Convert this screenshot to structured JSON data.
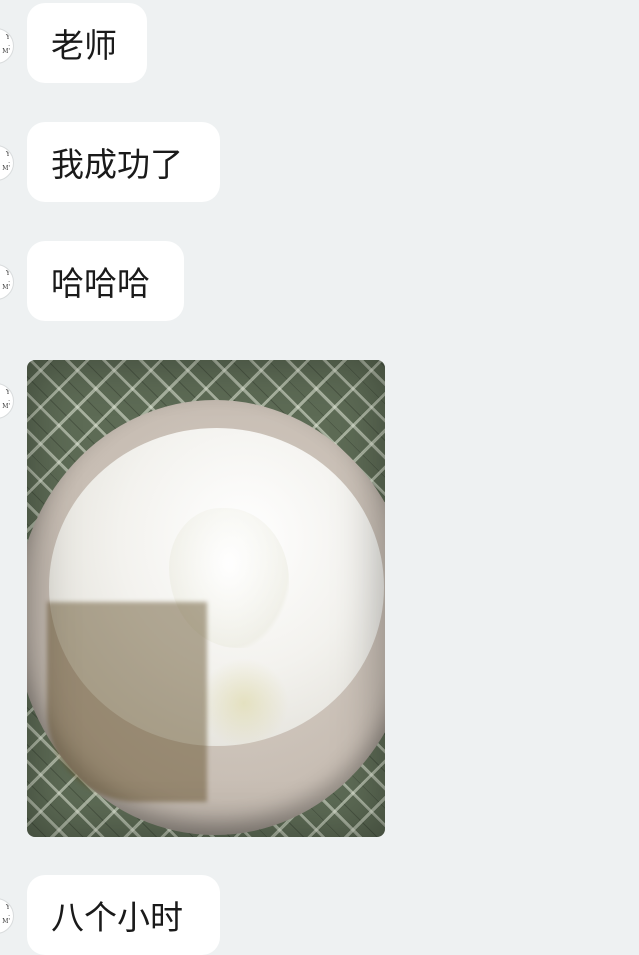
{
  "chat": {
    "avatar_text": "Y\n.\nM'",
    "messages": [
      {
        "type": "text",
        "text": "老师"
      },
      {
        "type": "text",
        "text": "我成功了"
      },
      {
        "type": "text",
        "text": "哈哈哈"
      },
      {
        "type": "image",
        "description": "bowl-of-yogurt-photo"
      },
      {
        "type": "text",
        "text": "八个小时"
      }
    ]
  },
  "colors": {
    "background": "#eef1f2",
    "bubble": "#ffffff",
    "text": "#1a1a1a"
  }
}
